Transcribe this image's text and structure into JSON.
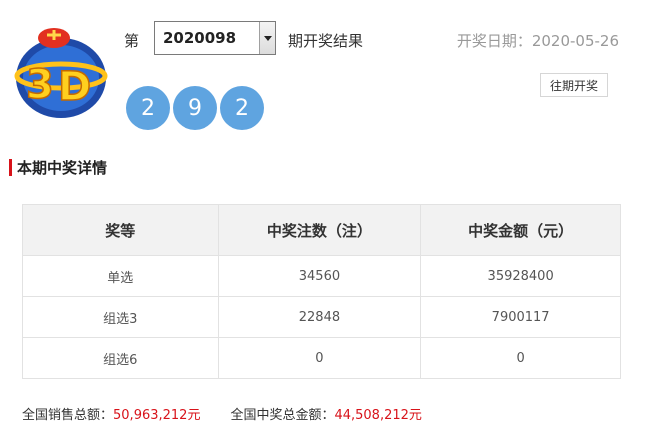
{
  "header": {
    "issue_prefix": "第",
    "issue_selected": "2020098",
    "issue_suffix": "期开奖结果",
    "draw_date": "开奖日期：2020-05-26",
    "history_button": "往期开奖"
  },
  "balls": [
    "2",
    "9",
    "2"
  ],
  "section_title": "本期中奖详情",
  "table": {
    "headers": [
      "奖等",
      "中奖注数（注）",
      "中奖金额（元）"
    ],
    "rows": [
      [
        "单选",
        "34560",
        "35928400"
      ],
      [
        "组选3",
        "22848",
        "7900117"
      ],
      [
        "组选6",
        "0",
        "0"
      ]
    ]
  },
  "totals": {
    "sales_label": "全国销售总额：",
    "sales_value": "50,963,212元",
    "prize_label": "全国中奖总金额：",
    "prize_value": "44,508,212元"
  },
  "colors": {
    "ball": "#5fa4e0",
    "accent_red": "#d8131a",
    "table_header_bg": "#f2f2f2"
  },
  "icons": {
    "logo": "lottery-3d-logo-icon",
    "dropdown": "chevron-down-icon"
  }
}
